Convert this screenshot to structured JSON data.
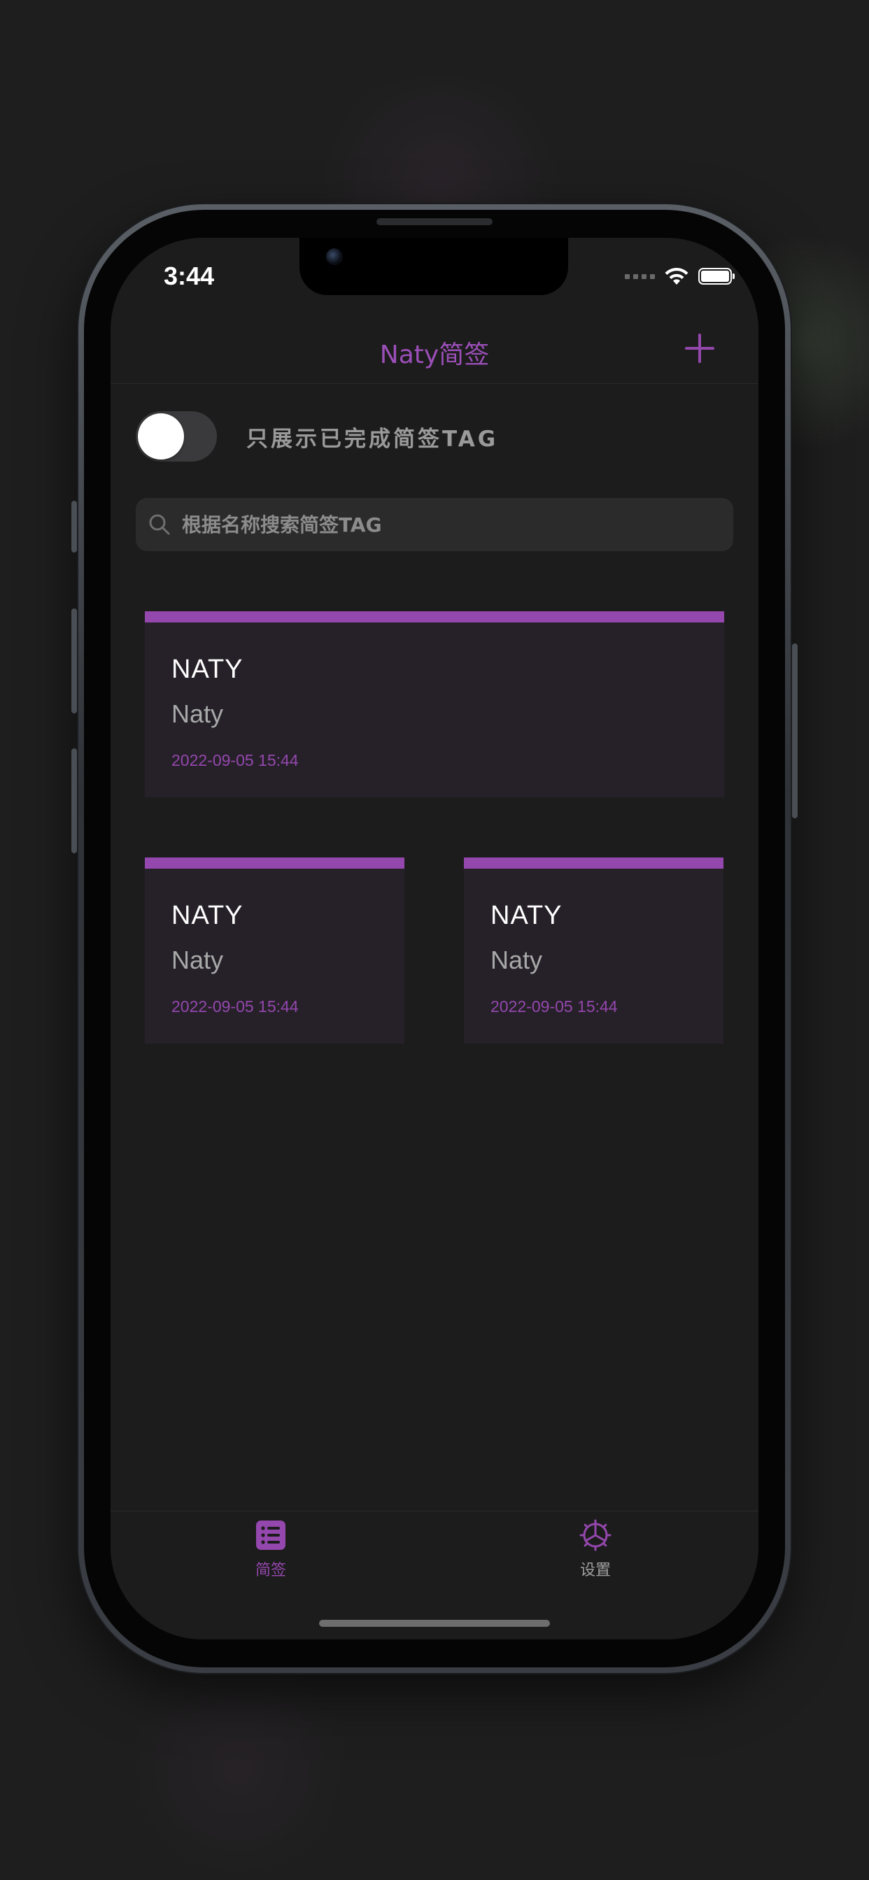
{
  "status_bar": {
    "time": "3:44"
  },
  "nav": {
    "title": "Naty简签",
    "add_icon": "plus-icon"
  },
  "filter": {
    "label": "只展示已完成简签TAG",
    "toggle_on": false
  },
  "search": {
    "placeholder": "根据名称搜索简签TAG",
    "value": "",
    "icon": "search-icon"
  },
  "cards": [
    {
      "title": "NATY",
      "subtitle": "Naty",
      "date": "2022-09-05 15:44"
    },
    {
      "title": "NATY",
      "subtitle": "Naty",
      "date": "2022-09-05 15:44"
    },
    {
      "title": "NATY",
      "subtitle": "Naty",
      "date": "2022-09-05 15:44"
    }
  ],
  "tabs": [
    {
      "label": "简签",
      "icon": "list-icon",
      "active": true
    },
    {
      "label": "设置",
      "icon": "gear-icon",
      "active": false
    }
  ],
  "colors": {
    "accent": "#9447ad",
    "background": "#1c1c1c",
    "card": "#262129",
    "inactive": "#a0a0a0"
  }
}
